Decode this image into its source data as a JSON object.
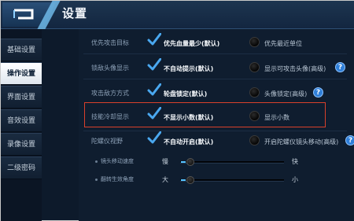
{
  "header": {
    "title": "设置",
    "back_icon": "back-arrow-icon"
  },
  "sidebar": {
    "items": [
      {
        "label": "基础设置",
        "active": false
      },
      {
        "label": "操作设置",
        "active": true
      },
      {
        "label": "界面设置",
        "active": false
      },
      {
        "label": "音效设置",
        "active": false
      },
      {
        "label": "录像设置",
        "active": false
      },
      {
        "label": "二级密码",
        "active": false
      }
    ]
  },
  "settings": {
    "rows": [
      {
        "label": "优先攻击目标",
        "option_a": "优先血量最少(默认)",
        "option_a_selected": true,
        "option_b": "优先最近单位",
        "option_b_selected": false,
        "help": false
      },
      {
        "label": "锁敌头像显示",
        "option_a": "不自动提示(默认)",
        "option_a_selected": true,
        "option_b": "显示可攻击头像(高级)",
        "option_b_selected": false,
        "help": true
      },
      {
        "label": "攻击敌方方式",
        "option_a": "轮盘锁定(默认)",
        "option_a_selected": true,
        "option_b": "头像锁定(高级)",
        "option_b_selected": false,
        "help": true
      },
      {
        "label": "技能冷却显示",
        "option_a": "不显示小数(默认)",
        "option_a_selected": true,
        "option_b": "显示小数",
        "option_b_selected": false,
        "help": false
      },
      {
        "label": "陀螺仪视野",
        "option_a": "不自动开启(默认)",
        "option_a_selected": true,
        "option_b": "开启陀螺仪镜头移动(高级)",
        "option_b_selected": false,
        "help": true
      }
    ],
    "help_glyph": "?",
    "sliders": [
      {
        "label": "镜头移动速度",
        "min_label": "慢",
        "max_label": "快",
        "value": 0.0
      },
      {
        "label": "翻转生效角度",
        "min_label": "大",
        "max_label": "小",
        "value": 0.0
      }
    ]
  },
  "colors": {
    "accent": "#2f7fd9",
    "highlight_box": "#d9402b",
    "check": "#4aa8f0"
  }
}
